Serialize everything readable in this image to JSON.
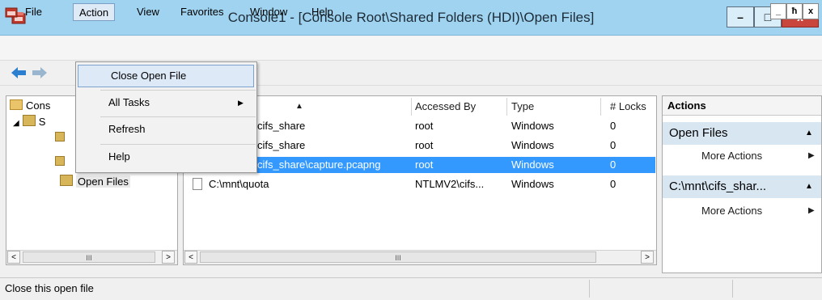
{
  "window": {
    "title": "Console1 - [Console Root\\Shared Folders (HDI)\\Open Files]",
    "icon": "mmc-icon",
    "controls": {
      "minimize": "–",
      "maximize": "□",
      "close": "x"
    }
  },
  "menubar": {
    "items": [
      "File",
      "Action",
      "View",
      "Favorites",
      "Window",
      "Help"
    ],
    "mdi_controls": [
      "_",
      "ħ",
      "x"
    ]
  },
  "toolbar": {
    "back_icon": "back-arrow-icon",
    "forward_icon": "forward-arrow-icon"
  },
  "tree": {
    "items": [
      "Cons",
      "S",
      "Open Files"
    ]
  },
  "list": {
    "columns": [
      "",
      "Accessed By",
      "Type",
      "# Locks"
    ],
    "sort_indicator": "▲",
    "rows": [
      {
        "name": "cifs_share",
        "accessed_by": "root",
        "type": "Windows",
        "locks": "0"
      },
      {
        "name": "cifs_share",
        "accessed_by": "root",
        "type": "Windows",
        "locks": "0"
      },
      {
        "name": "cifs_share\\capture.pcapng",
        "accessed_by": "root",
        "type": "Windows",
        "locks": "0",
        "selected": true
      },
      {
        "name": "C:\\mnt\\quota",
        "accessed_by": "NTLMV2\\cifs...",
        "type": "Windows",
        "locks": "0"
      }
    ]
  },
  "context_menu": {
    "items": [
      {
        "label": "Close Open File",
        "highlighted": true
      },
      {
        "label": "All Tasks",
        "has_submenu": true
      },
      {
        "label": "Refresh"
      },
      {
        "label": "Help"
      }
    ],
    "submenu_arrow": "▶"
  },
  "actions": {
    "header": "Actions",
    "sections": [
      {
        "title": "Open Files",
        "items": [
          "More Actions"
        ]
      },
      {
        "title": "C:\\mnt\\cifs_shar...",
        "items": [
          "More Actions"
        ]
      }
    ],
    "collapse_arrow": "▲",
    "item_arrow": "▶"
  },
  "scroll": {
    "left": "<",
    "right": ">",
    "thumb": "III"
  },
  "status": {
    "text": "Close this open file"
  },
  "colors": {
    "selection": "#3399ff",
    "titlebar": "#9fd3f0",
    "close_button": "#c9463d"
  }
}
